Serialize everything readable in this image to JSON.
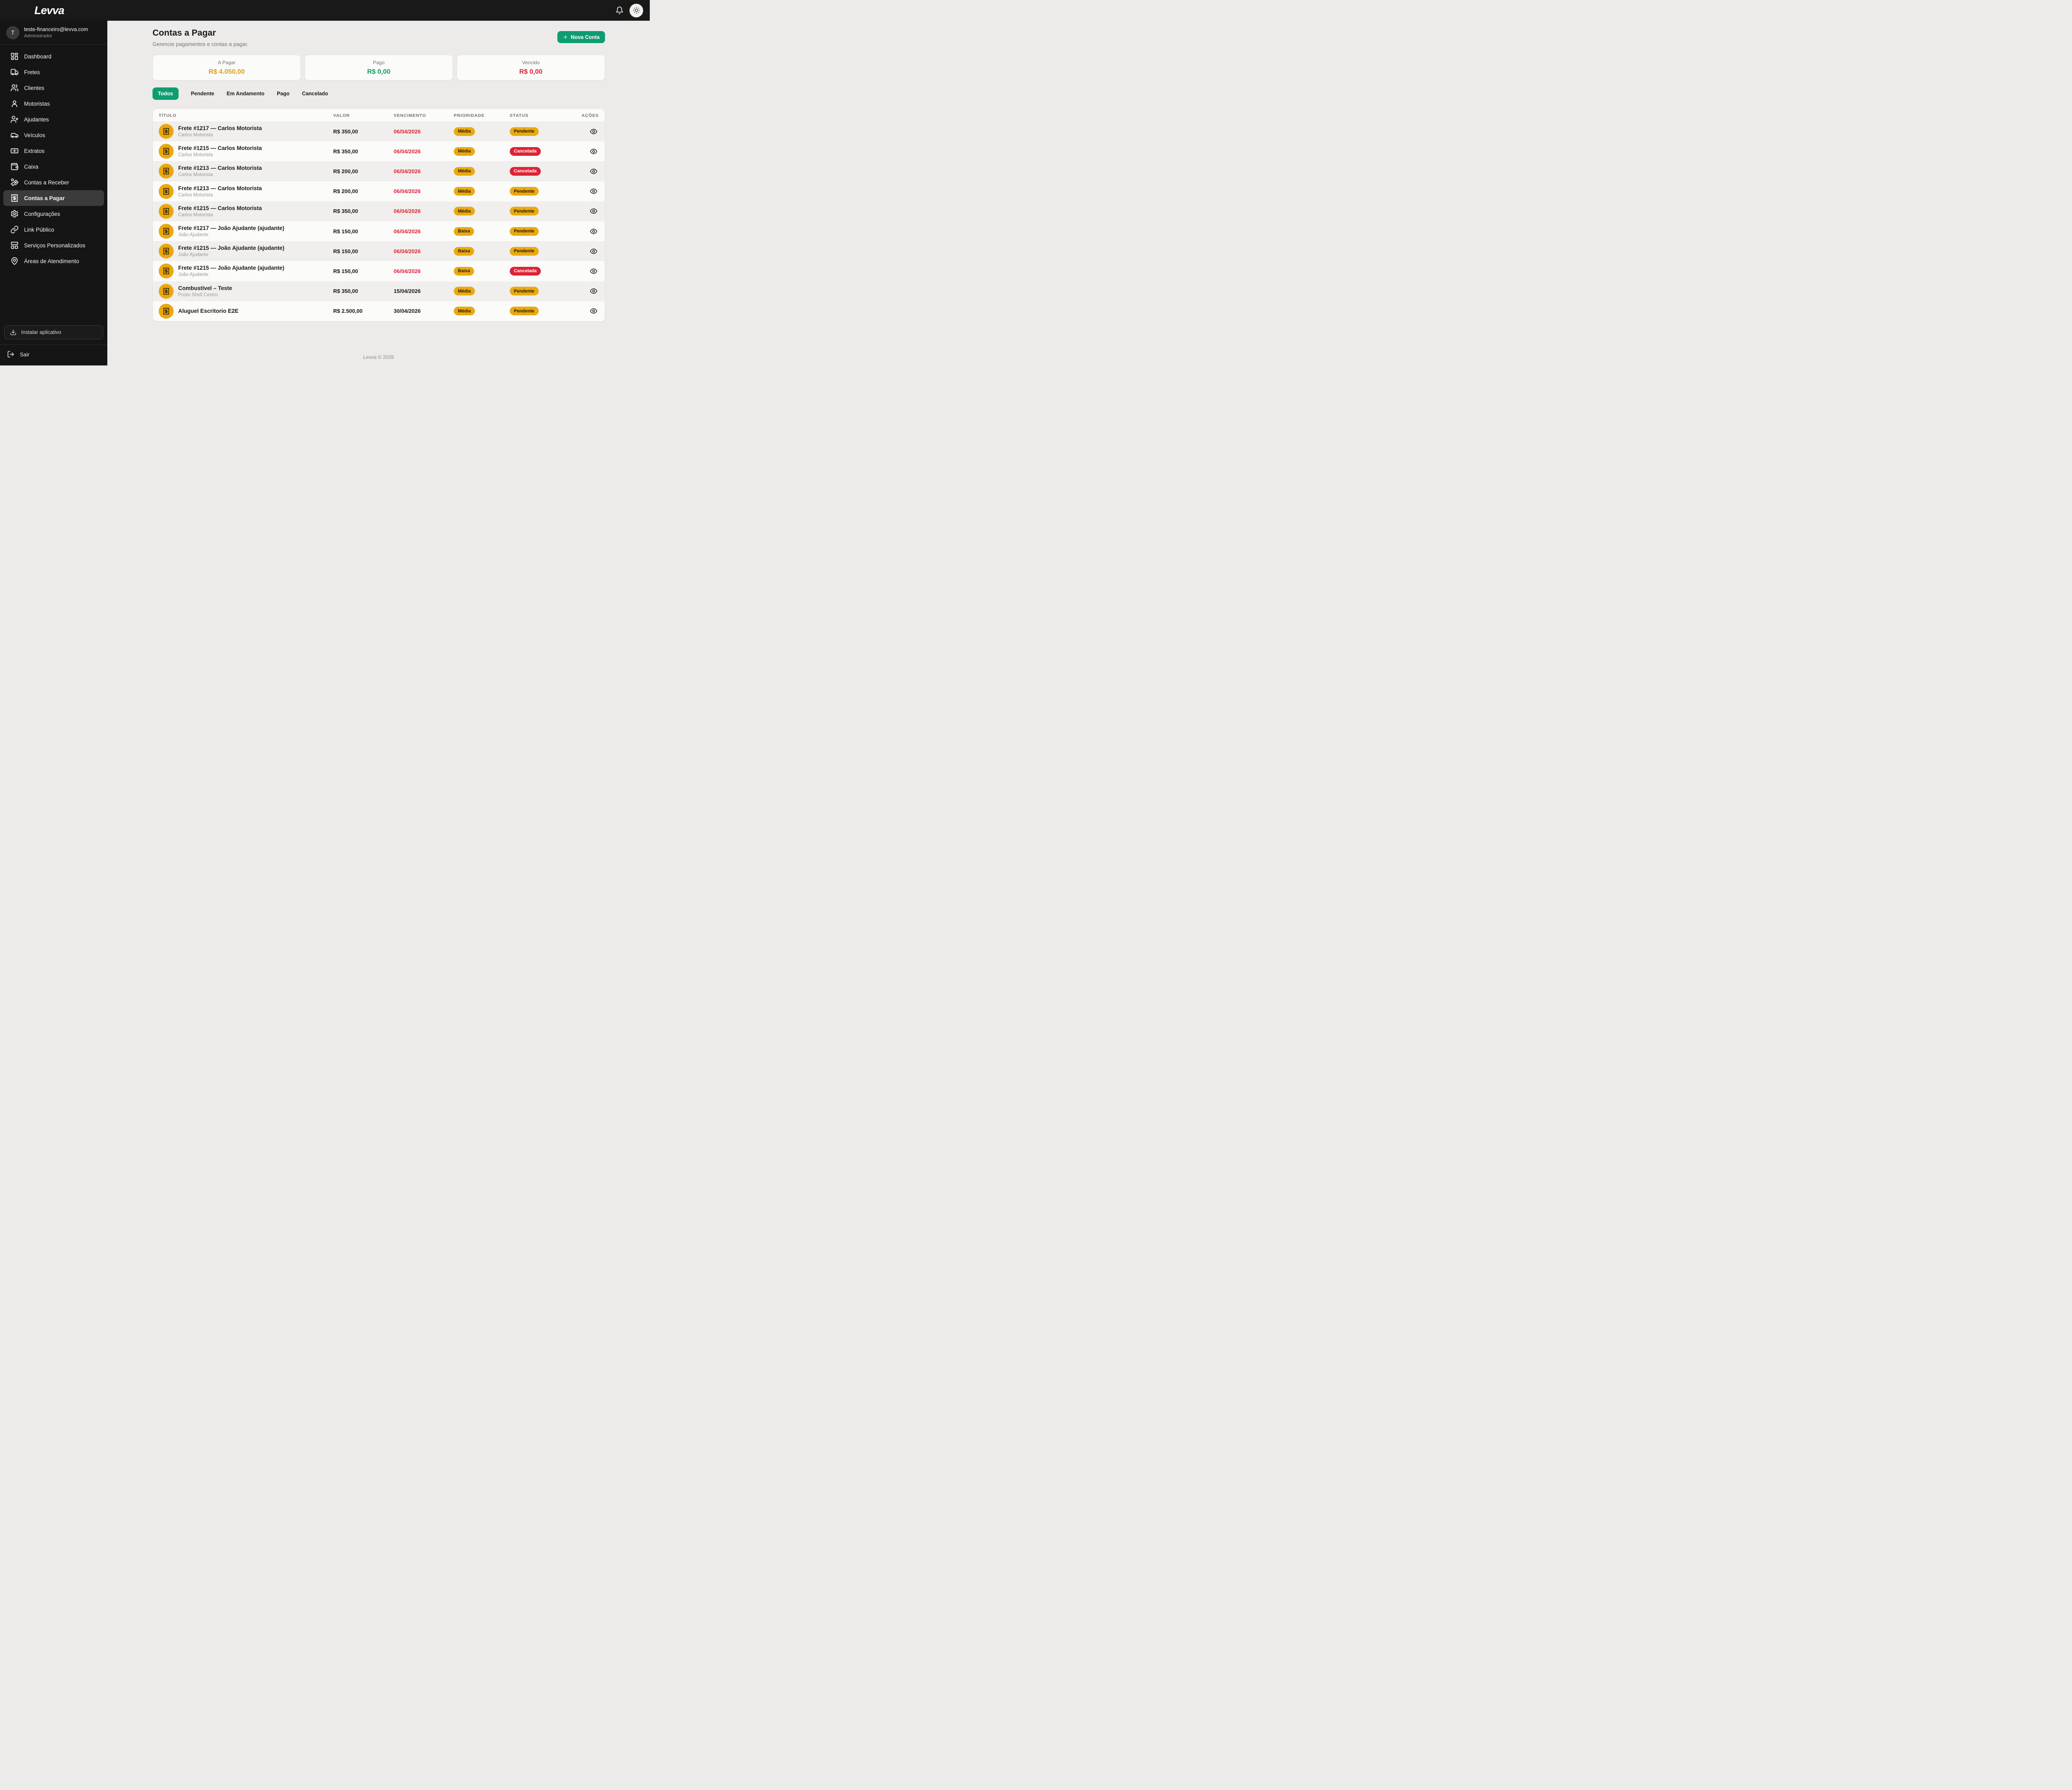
{
  "topbar": {
    "logo": "Levva",
    "icons": [
      "bell-icon",
      "sun-icon"
    ]
  },
  "sidebar": {
    "user": {
      "initial": "T",
      "email": "teste-financeiro@levva.com",
      "role": "Administrador"
    },
    "items": [
      {
        "icon": "dashboard",
        "label": "Dashboard",
        "active": false
      },
      {
        "icon": "truck",
        "label": "Fretes",
        "active": false
      },
      {
        "icon": "users",
        "label": "Clientes",
        "active": false
      },
      {
        "icon": "user",
        "label": "Motoristas",
        "active": false
      },
      {
        "icon": "user-plus",
        "label": "Ajudantes",
        "active": false
      },
      {
        "icon": "car",
        "label": "Veículos",
        "active": false
      },
      {
        "icon": "banknote",
        "label": "Extratos",
        "active": false
      },
      {
        "icon": "wallet",
        "label": "Caixa",
        "active": false
      },
      {
        "icon": "hand-coins",
        "label": "Contas a Receber",
        "active": false
      },
      {
        "icon": "receipt",
        "label": "Contas a Pagar",
        "active": true
      },
      {
        "icon": "gear",
        "label": "Configurações",
        "active": false
      },
      {
        "icon": "link",
        "label": "Link Público",
        "active": false
      },
      {
        "icon": "panels",
        "label": "Serviços Personalizados",
        "active": false
      },
      {
        "icon": "map-pin",
        "label": "Áreas de Atendimento",
        "active": false
      }
    ],
    "install_label": "Instalar aplicativo",
    "logout_label": "Sair"
  },
  "header": {
    "title": "Contas a Pagar",
    "subtitle": "Gerencie pagamentos e contas a pagar.",
    "new_button": "Nova Conta"
  },
  "summary_cards": [
    {
      "label": "A Pagar",
      "value": "R$ 4.050,00",
      "color": "#DD9F13"
    },
    {
      "label": "Pago",
      "value": "R$ 0,00",
      "color": "#0AA05C"
    },
    {
      "label": "Vencido",
      "value": "R$ 0,00",
      "color": "#DE2334"
    }
  ],
  "filters": [
    {
      "label": "Todos",
      "active": true
    },
    {
      "label": "Pendente",
      "active": false
    },
    {
      "label": "Em Andamento",
      "active": false
    },
    {
      "label": "Pago",
      "active": false
    },
    {
      "label": "Cancelado",
      "active": false
    }
  ],
  "table": {
    "columns": [
      "Título",
      "Valor",
      "Vencimento",
      "Prioridade",
      "Status",
      "Ações"
    ],
    "rows": [
      {
        "title": "Frete #1217 — Carlos Motorista",
        "subtitle": "Carlos Motorista",
        "value": "R$ 350,00",
        "due": "06/04/2026",
        "due_overdue": true,
        "priority": "Média",
        "priority_class": "yellow",
        "status": "Pendente",
        "status_class": "yellow"
      },
      {
        "title": "Frete #1215 — Carlos Motorista",
        "subtitle": "Carlos Motorista",
        "value": "R$ 350,00",
        "due": "06/04/2026",
        "due_overdue": true,
        "priority": "Média",
        "priority_class": "yellow",
        "status": "Cancelada",
        "status_class": "red"
      },
      {
        "title": "Frete #1213 — Carlos Motorista",
        "subtitle": "Carlos Motorista",
        "value": "R$ 200,00",
        "due": "06/04/2026",
        "due_overdue": true,
        "priority": "Média",
        "priority_class": "yellow",
        "status": "Cancelada",
        "status_class": "red"
      },
      {
        "title": "Frete #1213 — Carlos Motorista",
        "subtitle": "Carlos Motorista",
        "value": "R$ 200,00",
        "due": "06/04/2026",
        "due_overdue": true,
        "priority": "Média",
        "priority_class": "yellow",
        "status": "Pendente",
        "status_class": "yellow"
      },
      {
        "title": "Frete #1215 — Carlos Motorista",
        "subtitle": "Carlos Motorista",
        "value": "R$ 350,00",
        "due": "06/04/2026",
        "due_overdue": true,
        "priority": "Média",
        "priority_class": "yellow",
        "status": "Pendente",
        "status_class": "yellow"
      },
      {
        "title": "Frete #1217 — João Ajudante (ajudante)",
        "subtitle": "João Ajudante",
        "value": "R$ 150,00",
        "due": "06/04/2026",
        "due_overdue": true,
        "priority": "Baixa",
        "priority_class": "yellow",
        "status": "Pendente",
        "status_class": "yellow"
      },
      {
        "title": "Frete #1215 — João Ajudante (ajudante)",
        "subtitle": "João Ajudante",
        "value": "R$ 150,00",
        "due": "06/04/2026",
        "due_overdue": true,
        "priority": "Baixa",
        "priority_class": "yellow",
        "status": "Pendente",
        "status_class": "yellow"
      },
      {
        "title": "Frete #1215 — João Ajudante (ajudante)",
        "subtitle": "João Ajudante",
        "value": "R$ 150,00",
        "due": "06/04/2026",
        "due_overdue": true,
        "priority": "Baixa",
        "priority_class": "yellow",
        "status": "Cancelada",
        "status_class": "red"
      },
      {
        "title": "Combustível – Teste",
        "subtitle": "Posto Shell Centro",
        "value": "R$ 350,00",
        "due": "15/04/2026",
        "due_overdue": false,
        "priority": "Média",
        "priority_class": "yellow",
        "status": "Pendente",
        "status_class": "yellow"
      },
      {
        "title": "Aluguel Escritorio E2E",
        "subtitle": "",
        "value": "R$ 2.500,00",
        "due": "30/04/2026",
        "due_overdue": false,
        "priority": "Média",
        "priority_class": "yellow",
        "status": "Pendente",
        "status_class": "yellow"
      }
    ]
  },
  "footer": {
    "text": "Levva © 2026"
  },
  "colors": {
    "accent_green": "#0E9D71",
    "badge_yellow": "#EBA90F",
    "badge_red": "#DE2334",
    "value_amber": "#DD9F13",
    "value_green": "#0AA05C",
    "value_red": "#DE2334",
    "sidebar_bg": "#151515",
    "topbar_bg": "#191919",
    "main_bg": "#ECEBE9",
    "card_bg": "#FBFBF9"
  }
}
